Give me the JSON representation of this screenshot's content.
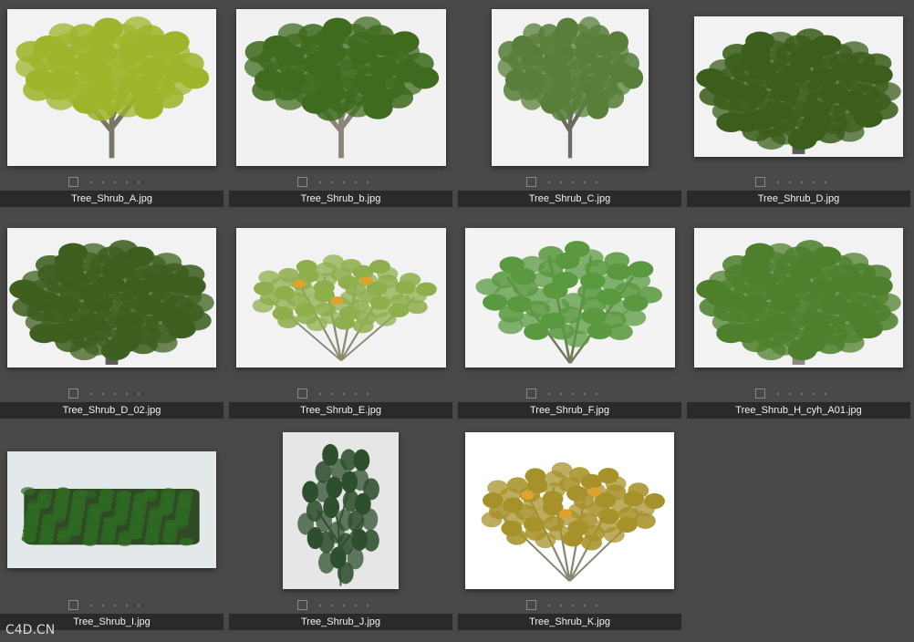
{
  "watermark": "C4D.CN",
  "items": [
    {
      "filename": "Tree_Shrub_A.jpg",
      "icon": "tree-icon",
      "bg": "#f2f2f2",
      "leaf": "#9cb52b",
      "trunk": "#7a7666",
      "shape": "tree"
    },
    {
      "filename": "Tree_Shrub_b.jpg",
      "icon": "tree-icon",
      "bg": "#f1f1f1",
      "leaf": "#3f6b1e",
      "trunk": "#8a8577",
      "shape": "tree"
    },
    {
      "filename": "Tree_Shrub_C.jpg",
      "icon": "tree-icon",
      "bg": "#f2f2f2",
      "leaf": "#587e3a",
      "trunk": "#6b6b63",
      "shape": "tree"
    },
    {
      "filename": "Tree_Shrub_D.jpg",
      "icon": "shrub-icon",
      "bg": "#f2f2f2",
      "leaf": "#3c5e1c",
      "trunk": "#5f5b52",
      "shape": "bush"
    },
    {
      "filename": "Tree_Shrub_D_02.jpg",
      "icon": "shrub-icon",
      "bg": "#f2f2f2",
      "leaf": "#3e5f1f",
      "trunk": "#5f5b52",
      "shape": "bush"
    },
    {
      "filename": "Tree_Shrub_E.jpg",
      "icon": "flowering-shrub-icon",
      "bg": "#f2f2f2",
      "leaf": "#8fae4c",
      "trunk": "#8b8a6e",
      "shape": "spray"
    },
    {
      "filename": "Tree_Shrub_F.jpg",
      "icon": "shrub-icon",
      "bg": "#f3f3f3",
      "leaf": "#5a9940",
      "trunk": "#6f7a5a",
      "shape": "fan"
    },
    {
      "filename": "Tree_Shrub_H_cyh_A01.jpg",
      "icon": "shrub-icon",
      "bg": "#f2f2f2",
      "leaf": "#4d7f2c",
      "trunk": "#8a8a85",
      "shape": "bush"
    },
    {
      "filename": "Tree_Shrub_I.jpg",
      "icon": "hedge-icon",
      "bg": "#e3e8ea",
      "leaf": "#2f6a24",
      "trunk": "#2f4a24",
      "shape": "hedge"
    },
    {
      "filename": "Tree_Shrub_J.jpg",
      "icon": "plant-icon",
      "bg": "#e6e6e6",
      "leaf": "#2e4f2e",
      "trunk": "#4d5a45",
      "shape": "vine"
    },
    {
      "filename": "Tree_Shrub_K.jpg",
      "icon": "shrub-icon",
      "bg": "#ffffff",
      "leaf": "#a7922a",
      "trunk": "#8a8674",
      "shape": "spray"
    }
  ]
}
